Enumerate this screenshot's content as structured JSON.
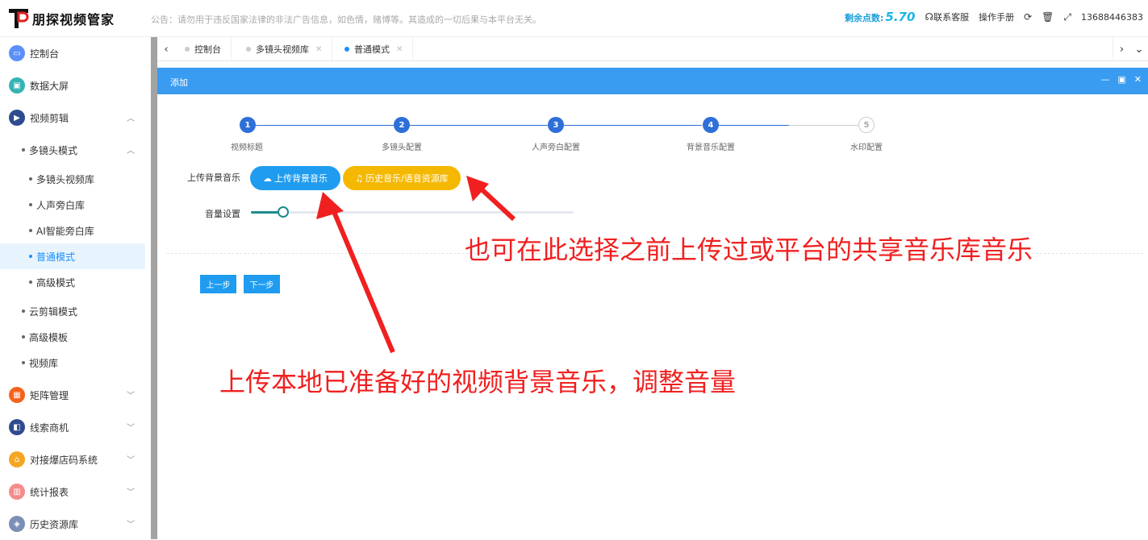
{
  "app": {
    "logo_text": "朋探视频管家"
  },
  "notice": "公告：请勿用于违反国家法律的非法广告信息，如色情，赌博等。其造成的一切后果与本平台无关。",
  "header": {
    "points_label": "剩余点数:",
    "points_value": "5.70",
    "contact": "联系客服",
    "manual": "操作手册",
    "phone": "13688446383"
  },
  "sidebar": {
    "items": [
      {
        "label": "控制台",
        "color": "#5b8ff9",
        "icon": "monitor-icon"
      },
      {
        "label": "数据大屏",
        "color": "#36b3b5",
        "icon": "screen-icon"
      },
      {
        "label": "视频剪辑",
        "color": "#2f4b8f",
        "icon": "video-edit-icon"
      },
      {
        "label": "矩阵管理",
        "color": "#f5631b",
        "icon": "grid-icon"
      },
      {
        "label": "线索商机",
        "color": "#2f4b8f",
        "icon": "chart-icon"
      },
      {
        "label": "对接爆店码系统",
        "color": "#f5a623",
        "icon": "shop-icon"
      },
      {
        "label": "统计报表",
        "color": "#f58b8b",
        "icon": "bar-icon"
      },
      {
        "label": "历史资源库",
        "color": "#7c8fb5",
        "icon": "layers-icon"
      }
    ],
    "sub": {
      "multi_lens": "多镜头模式",
      "multi_lens_children": [
        "多镜头视频库",
        "人声旁白库",
        "AI智能旁白库",
        "普通模式",
        "高级模式"
      ],
      "cloud_edit": "云剪辑模式",
      "advanced_template": "高级模板",
      "video_library": "视频库"
    }
  },
  "tabs": [
    {
      "label": "控制台",
      "active": false
    },
    {
      "label": "多镜头视频库",
      "active": false
    },
    {
      "label": "普通模式",
      "active": true
    }
  ],
  "dialog": {
    "title": "添加",
    "steps": [
      {
        "num": "1",
        "label": "视频标题",
        "done": true
      },
      {
        "num": "2",
        "label": "多镜头配置",
        "done": true
      },
      {
        "num": "3",
        "label": "人声旁白配置",
        "done": true
      },
      {
        "num": "4",
        "label": "背景音乐配置",
        "done": true
      },
      {
        "num": "5",
        "label": "水印配置",
        "done": false
      }
    ],
    "upload_label": "上传背景音乐",
    "upload_button": "上传背景音乐",
    "history_button": "历史音乐/语音资源库",
    "volume_label": "音量设置",
    "volume_fraction": 0.1,
    "prev_button": "上一步",
    "next_button": "下一步"
  },
  "annotations": {
    "top": "也可在此选择之前上传过或平台的共享音乐库音乐",
    "bottom": "上传本地已准备好的视频背景音乐，调整音量",
    "color": "#f02020"
  }
}
